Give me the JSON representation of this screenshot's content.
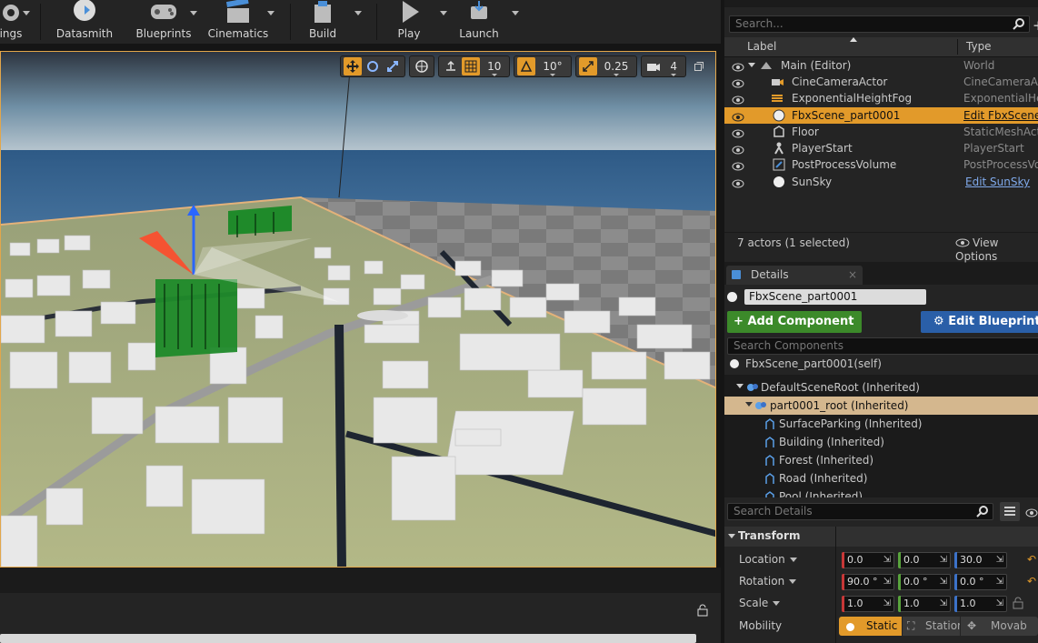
{
  "toolbar": {
    "items": [
      {
        "label": "ings",
        "icon": "settings-icon"
      },
      {
        "label": "Datasmith",
        "icon": "datasmith-icon"
      },
      {
        "label": "Blueprints",
        "icon": "blueprints-icon"
      },
      {
        "label": "Cinematics",
        "icon": "clapperboard-icon"
      },
      {
        "label": "Build",
        "icon": "build-icon"
      },
      {
        "label": "Play",
        "icon": "play-icon"
      },
      {
        "label": "Launch",
        "icon": "launch-icon"
      }
    ]
  },
  "viewport": {
    "grid_snap": "10",
    "rotation_snap": "10°",
    "scale_snap": "0.25",
    "camera_speed": "4"
  },
  "outliner": {
    "search_placeholder": "Search...",
    "col_label": "Label",
    "col_type": "Type",
    "rows": [
      {
        "label": "Main (Editor)",
        "type": "World",
        "icon": "world-icon"
      },
      {
        "label": "CineCameraActor",
        "type": "CineCameraActo",
        "icon": "cine-camera-icon"
      },
      {
        "label": "ExponentialHeightFog",
        "type": "ExponentialHei",
        "icon": "fog-icon"
      },
      {
        "label": "FbxScene_part0001",
        "type": "Edit FbxScene",
        "icon": "sphere-icon",
        "selected": true,
        "link": true
      },
      {
        "label": "Floor",
        "type": "StaticMeshActo",
        "icon": "static-mesh-icon"
      },
      {
        "label": "PlayerStart",
        "type": "PlayerStart",
        "icon": "player-start-icon"
      },
      {
        "label": "PostProcessVolume",
        "type": "PostProcessVo",
        "icon": "post-process-icon"
      },
      {
        "label": "SunSky",
        "type": "Edit SunSky",
        "icon": "sphere-icon",
        "link": true
      }
    ],
    "status": "7 actors (1 selected)",
    "view_options": "View Options"
  },
  "details": {
    "tab_label": "Details",
    "actor_name": "FbxScene_part0001",
    "add_component": "Add Component",
    "edit_blueprint": "Edit Blueprint",
    "search_components_placeholder": "Search Components",
    "self_label": "FbxScene_part0001(self)",
    "components": [
      {
        "label": "DefaultSceneRoot (Inherited)",
        "level": 0
      },
      {
        "label": "part0001_root (Inherited)",
        "level": 1,
        "selected": true
      },
      {
        "label": "SurfaceParking (Inherited)",
        "level": 2
      },
      {
        "label": "Building (Inherited)",
        "level": 2
      },
      {
        "label": "Forest (Inherited)",
        "level": 2
      },
      {
        "label": "Road (Inherited)",
        "level": 2
      },
      {
        "label": "Pool (Inherited)",
        "level": 2
      }
    ],
    "search_details_placeholder": "Search Details",
    "transform_header": "Transform",
    "location_label": "Location",
    "rotation_label": "Rotation",
    "scale_label": "Scale",
    "mobility_label": "Mobility",
    "location": [
      "0.0",
      "0.0",
      "30.0"
    ],
    "rotation": [
      "90.0 °",
      "0.0 °",
      "0.0 °"
    ],
    "scale": [
      "1.0",
      "1.0",
      "1.0"
    ],
    "mobility_options": [
      "Static",
      "Statior",
      "Movab"
    ],
    "colors": {
      "accent": "#e29a2a",
      "selected_component": "#d4b78e",
      "add_component_green": "#3c8a2a",
      "edit_blueprint_blue": "#2a5fa8"
    }
  }
}
